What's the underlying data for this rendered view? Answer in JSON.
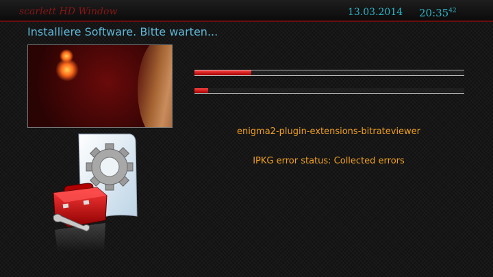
{
  "header": {
    "window_name": "scarlett HD Window",
    "date": "13.03.2014",
    "time": "20:35",
    "seconds": "42"
  },
  "title": "Installiere Software. Bitte warten...",
  "progress": {
    "overall": 0.21,
    "current": 0.05
  },
  "package_name": "enigma2-plugin-extensions-bitrateviewer",
  "status_message": "IPKG error status: Collected errors",
  "icons": {
    "software_icon": "toolbox-gear-wrench-icon"
  },
  "colors": {
    "accent_cyan": "#2bb7c9",
    "title_blue": "#5fb8d8",
    "message_orange": "#f0a020",
    "progress_red": "#e02020"
  }
}
